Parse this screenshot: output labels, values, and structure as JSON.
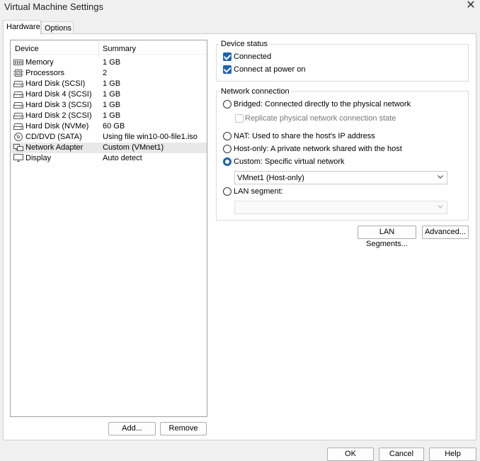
{
  "window": {
    "title": "Virtual Machine Settings",
    "close_glyph": "✕"
  },
  "tabs": [
    {
      "label": "Hardware"
    },
    {
      "label": "Options"
    }
  ],
  "device_list": {
    "headers": {
      "device": "Device",
      "summary": "Summary"
    },
    "rows": [
      {
        "icon": "memory-icon",
        "device": "Memory",
        "summary": "1 GB"
      },
      {
        "icon": "processor-icon",
        "device": "Processors",
        "summary": "2"
      },
      {
        "icon": "hard-disk-icon",
        "device": "Hard Disk (SCSI)",
        "summary": "1 GB"
      },
      {
        "icon": "hard-disk-icon",
        "device": "Hard Disk 4 (SCSI)",
        "summary": "1 GB"
      },
      {
        "icon": "hard-disk-icon",
        "device": "Hard Disk 3 (SCSI)",
        "summary": "1 GB"
      },
      {
        "icon": "hard-disk-icon",
        "device": "Hard Disk 2 (SCSI)",
        "summary": "1 GB"
      },
      {
        "icon": "hard-disk-icon",
        "device": "Hard Disk (NVMe)",
        "summary": "60 GB"
      },
      {
        "icon": "cd-dvd-icon",
        "device": "CD/DVD (SATA)",
        "summary": "Using file win10-00-file1.iso"
      },
      {
        "icon": "network-adapter-icon",
        "device": "Network Adapter",
        "summary": "Custom (VMnet1)",
        "selected": true
      },
      {
        "icon": "display-icon",
        "device": "Display",
        "summary": "Auto detect"
      }
    ],
    "add_label": "Add...",
    "remove_label": "Remove"
  },
  "device_status": {
    "title": "Device status",
    "connected": {
      "label": "Connected",
      "checked": true
    },
    "connect_at_power_on": {
      "label": "Connect at power on",
      "checked": true
    }
  },
  "network_connection": {
    "title": "Network connection",
    "bridged": "Bridged: Connected directly to the physical network",
    "replicate": "Replicate physical network connection state",
    "nat": "NAT: Used to share the host's IP address",
    "host_only": "Host-only: A private network shared with the host",
    "custom": "Custom: Specific virtual network",
    "selected_option": "custom",
    "custom_network_value": "VMnet1 (Host-only)",
    "lan_segment": "LAN segment:",
    "lan_segment_value": "",
    "lan_segments_button": "LAN Segments...",
    "advanced_button": "Advanced..."
  },
  "footer": {
    "ok": "OK",
    "cancel": "Cancel",
    "help": "Help"
  },
  "colors": {
    "accent": "#1a63b8",
    "selected_row": "#e8e8e8",
    "background": "#f0f0f0"
  }
}
